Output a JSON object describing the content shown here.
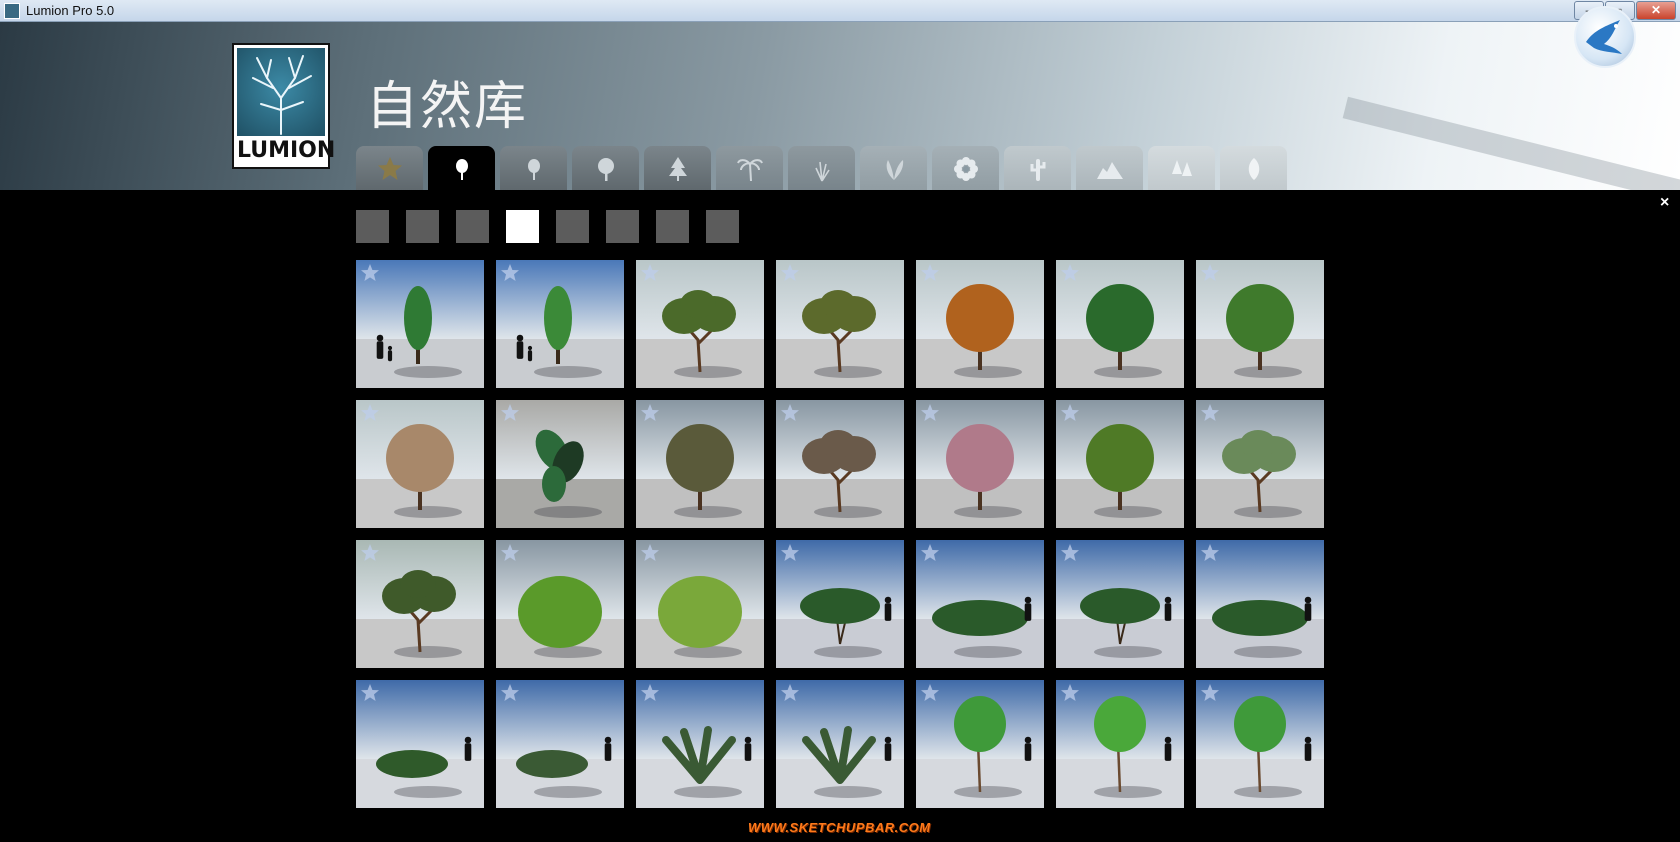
{
  "window": {
    "title": "Lumion Pro 5.0",
    "controls": [
      "–",
      "▫",
      "✕"
    ]
  },
  "header": {
    "logo_text": "LUMION",
    "page_title": "自然库"
  },
  "tabs": [
    {
      "icon": "star-icon",
      "active": false,
      "fade": 0
    },
    {
      "icon": "tree-icon",
      "active": true,
      "fade": 0
    },
    {
      "icon": "tree-icon",
      "active": false,
      "fade": 0
    },
    {
      "icon": "broadleaf-tree-icon",
      "active": false,
      "fade": 0
    },
    {
      "icon": "conifer-tree-icon",
      "active": false,
      "fade": 0
    },
    {
      "icon": "palm-tree-icon",
      "active": false,
      "fade": 1
    },
    {
      "icon": "grass-icon",
      "active": false,
      "fade": 1
    },
    {
      "icon": "plant-icon",
      "active": false,
      "fade": 2
    },
    {
      "icon": "flower-icon",
      "active": false,
      "fade": 2
    },
    {
      "icon": "cactus-icon",
      "active": false,
      "fade": 3
    },
    {
      "icon": "rock-icon",
      "active": false,
      "fade": 3
    },
    {
      "icon": "forest-icon",
      "active": false,
      "fade": 4
    },
    {
      "icon": "leaf-icon",
      "active": false,
      "fade": 4
    }
  ],
  "subcategories": {
    "count": 8,
    "active_index": 3
  },
  "close_label": "×",
  "thumbnails": [
    {
      "sky": "#4a78b8",
      "ground": "#c9ccd0",
      "foliage": "#2f7a34",
      "shape": "tall",
      "people": "two-left"
    },
    {
      "sky": "#4a78b8",
      "ground": "#c9ccd0",
      "foliage": "#3b8a38",
      "shape": "tall",
      "people": "two-left"
    },
    {
      "sky": "#b9c6c8",
      "ground": "#c8c8c8",
      "foliage": "#4b6a2a",
      "shape": "spread",
      "people": "none"
    },
    {
      "sky": "#b9c6c8",
      "ground": "#c8c8c8",
      "foliage": "#5c6a2c",
      "shape": "spread",
      "people": "none"
    },
    {
      "sky": "#b9c6c8",
      "ground": "#c8c8c8",
      "foliage": "#b0621e",
      "shape": "round",
      "people": "none"
    },
    {
      "sky": "#b9c6c8",
      "ground": "#c8c8c8",
      "foliage": "#2a6a2c",
      "shape": "round",
      "people": "none"
    },
    {
      "sky": "#b9c6c8",
      "ground": "#c8c8c8",
      "foliage": "#3f7a2c",
      "shape": "round",
      "people": "none"
    },
    {
      "sky": "#b9c6c8",
      "ground": "#c8c8c8",
      "foliage": "#a8886a",
      "shape": "round",
      "people": "none"
    },
    {
      "sky": "#a9a9a6",
      "ground": "#a9a9a6",
      "foliage": "#2c6a3a",
      "shape": "leafy",
      "people": "none"
    },
    {
      "sky": "#8896a2",
      "ground": "#c0c0c0",
      "foliage": "#5a5a3a",
      "shape": "round",
      "people": "none"
    },
    {
      "sky": "#8896a2",
      "ground": "#c0c0c0",
      "foliage": "#6a5a4a",
      "shape": "spread",
      "people": "none"
    },
    {
      "sky": "#8896a2",
      "ground": "#c0c0c0",
      "foliage": "#b07a8a",
      "shape": "round",
      "people": "none"
    },
    {
      "sky": "#8896a2",
      "ground": "#c0c0c0",
      "foliage": "#4f7a26",
      "shape": "round",
      "people": "none"
    },
    {
      "sky": "#8896a2",
      "ground": "#c0c0c0",
      "foliage": "#6a8a5a",
      "shape": "spread",
      "people": "none"
    },
    {
      "sky": "#a9b8b4",
      "ground": "#c8c8c8",
      "foliage": "#3f5a2a",
      "shape": "spread",
      "people": "none"
    },
    {
      "sky": "#8896a2",
      "ground": "#c8c8c8",
      "foliage": "#5a9a2a",
      "shape": "bush",
      "people": "none"
    },
    {
      "sky": "#8896a2",
      "ground": "#c8c8c8",
      "foliage": "#7aa83a",
      "shape": "bush",
      "people": "none"
    },
    {
      "sky": "#3f6aa8",
      "ground": "#c9ccd4",
      "foliage": "#2a5a2a",
      "shape": "umbrella",
      "people": "one-right"
    },
    {
      "sky": "#3f6aa8",
      "ground": "#c9ccd4",
      "foliage": "#2a5a2a",
      "shape": "low",
      "people": "one-right"
    },
    {
      "sky": "#3f6aa8",
      "ground": "#c9ccd4",
      "foliage": "#2a5a2a",
      "shape": "umbrella",
      "people": "one-right"
    },
    {
      "sky": "#3f6aa8",
      "ground": "#c9ccd4",
      "foliage": "#2a5a2a",
      "shape": "low",
      "people": "one-right"
    },
    {
      "sky": "#3f6aa8",
      "ground": "#d6d9de",
      "foliage": "#2f5a2a",
      "shape": "shrub",
      "people": "one-right"
    },
    {
      "sky": "#3f6aa8",
      "ground": "#d6d9de",
      "foliage": "#3a5a34",
      "shape": "shrub",
      "people": "one-right"
    },
    {
      "sky": "#3f6aa8",
      "ground": "#d6d9de",
      "foliage": "#3a5a34",
      "shape": "fern",
      "people": "one-right"
    },
    {
      "sky": "#3f6aa8",
      "ground": "#d6d9de",
      "foliage": "#3a5a34",
      "shape": "fern",
      "people": "one-right"
    },
    {
      "sky": "#3f6aa8",
      "ground": "#d6d9de",
      "foliage": "#3f9a3a",
      "shape": "young",
      "people": "one-right"
    },
    {
      "sky": "#3f6aa8",
      "ground": "#d6d9de",
      "foliage": "#4aa83a",
      "shape": "young",
      "people": "one-right"
    },
    {
      "sky": "#3f6aa8",
      "ground": "#d6d9de",
      "foliage": "#3f9a3a",
      "shape": "young",
      "people": "one-right"
    }
  ],
  "watermark": "WWW.SKETCHUPBAR.COM"
}
